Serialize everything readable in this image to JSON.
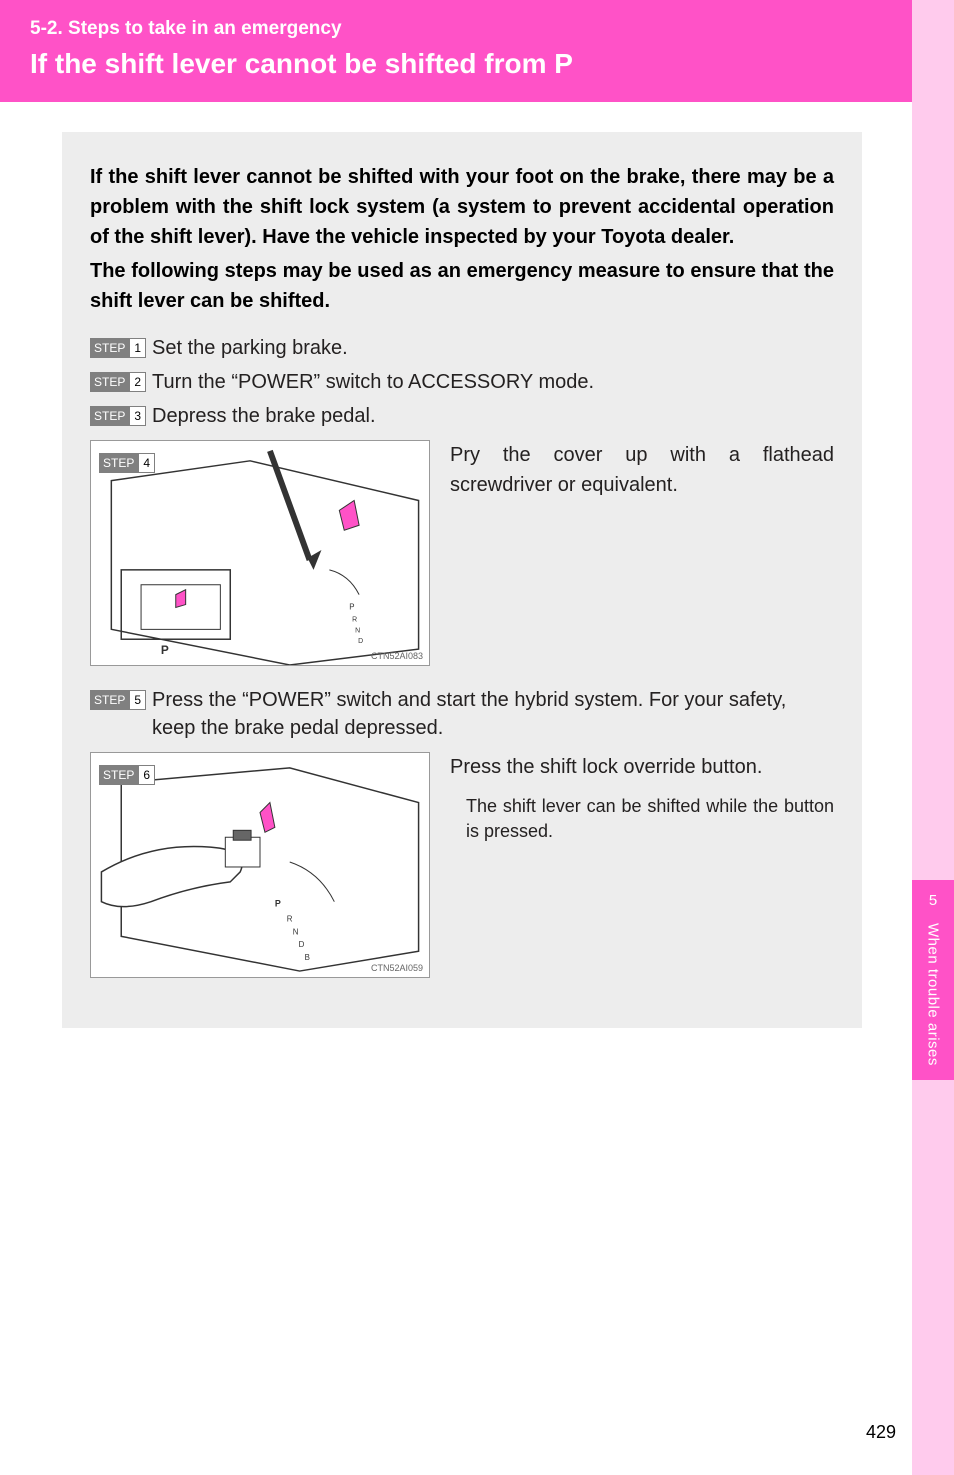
{
  "header": {
    "section_label": "5-2. Steps to take in an emergency",
    "title": "If the shift lever cannot be shifted from P"
  },
  "intro": {
    "para1": "If the shift lever cannot be shifted with your foot on the brake, there may be a problem with the shift lock system (a system to prevent accidental operation of the shift lever). Have the vehicle inspected by your Toyota dealer.",
    "para2": "The following steps may be used as an emergency measure to ensure that the shift lever can be shifted."
  },
  "step_word": "STEP",
  "steps": {
    "s1": {
      "num": "1",
      "text": "Set the parking brake."
    },
    "s2": {
      "num": "2",
      "text": "Turn the “POWER” switch to ACCESSORY mode."
    },
    "s3": {
      "num": "3",
      "text": "Depress the brake pedal."
    },
    "s4": {
      "num": "4",
      "text": "Pry the cover up with a flathead screwdriver or equivalent.",
      "img_code": "CTN52AI083"
    },
    "s5": {
      "num": "5",
      "text": "Press the “POWER” switch and start the hybrid system. For your safety, keep the brake pedal depressed."
    },
    "s6": {
      "num": "6",
      "text": "Press the shift lock override button.",
      "sub": "The shift lever can be shifted while the button is pressed.",
      "img_code": "CTN52AI059"
    }
  },
  "rail": {
    "chapter_num": "5",
    "chapter_text": "When trouble arises"
  },
  "page_number": "429"
}
